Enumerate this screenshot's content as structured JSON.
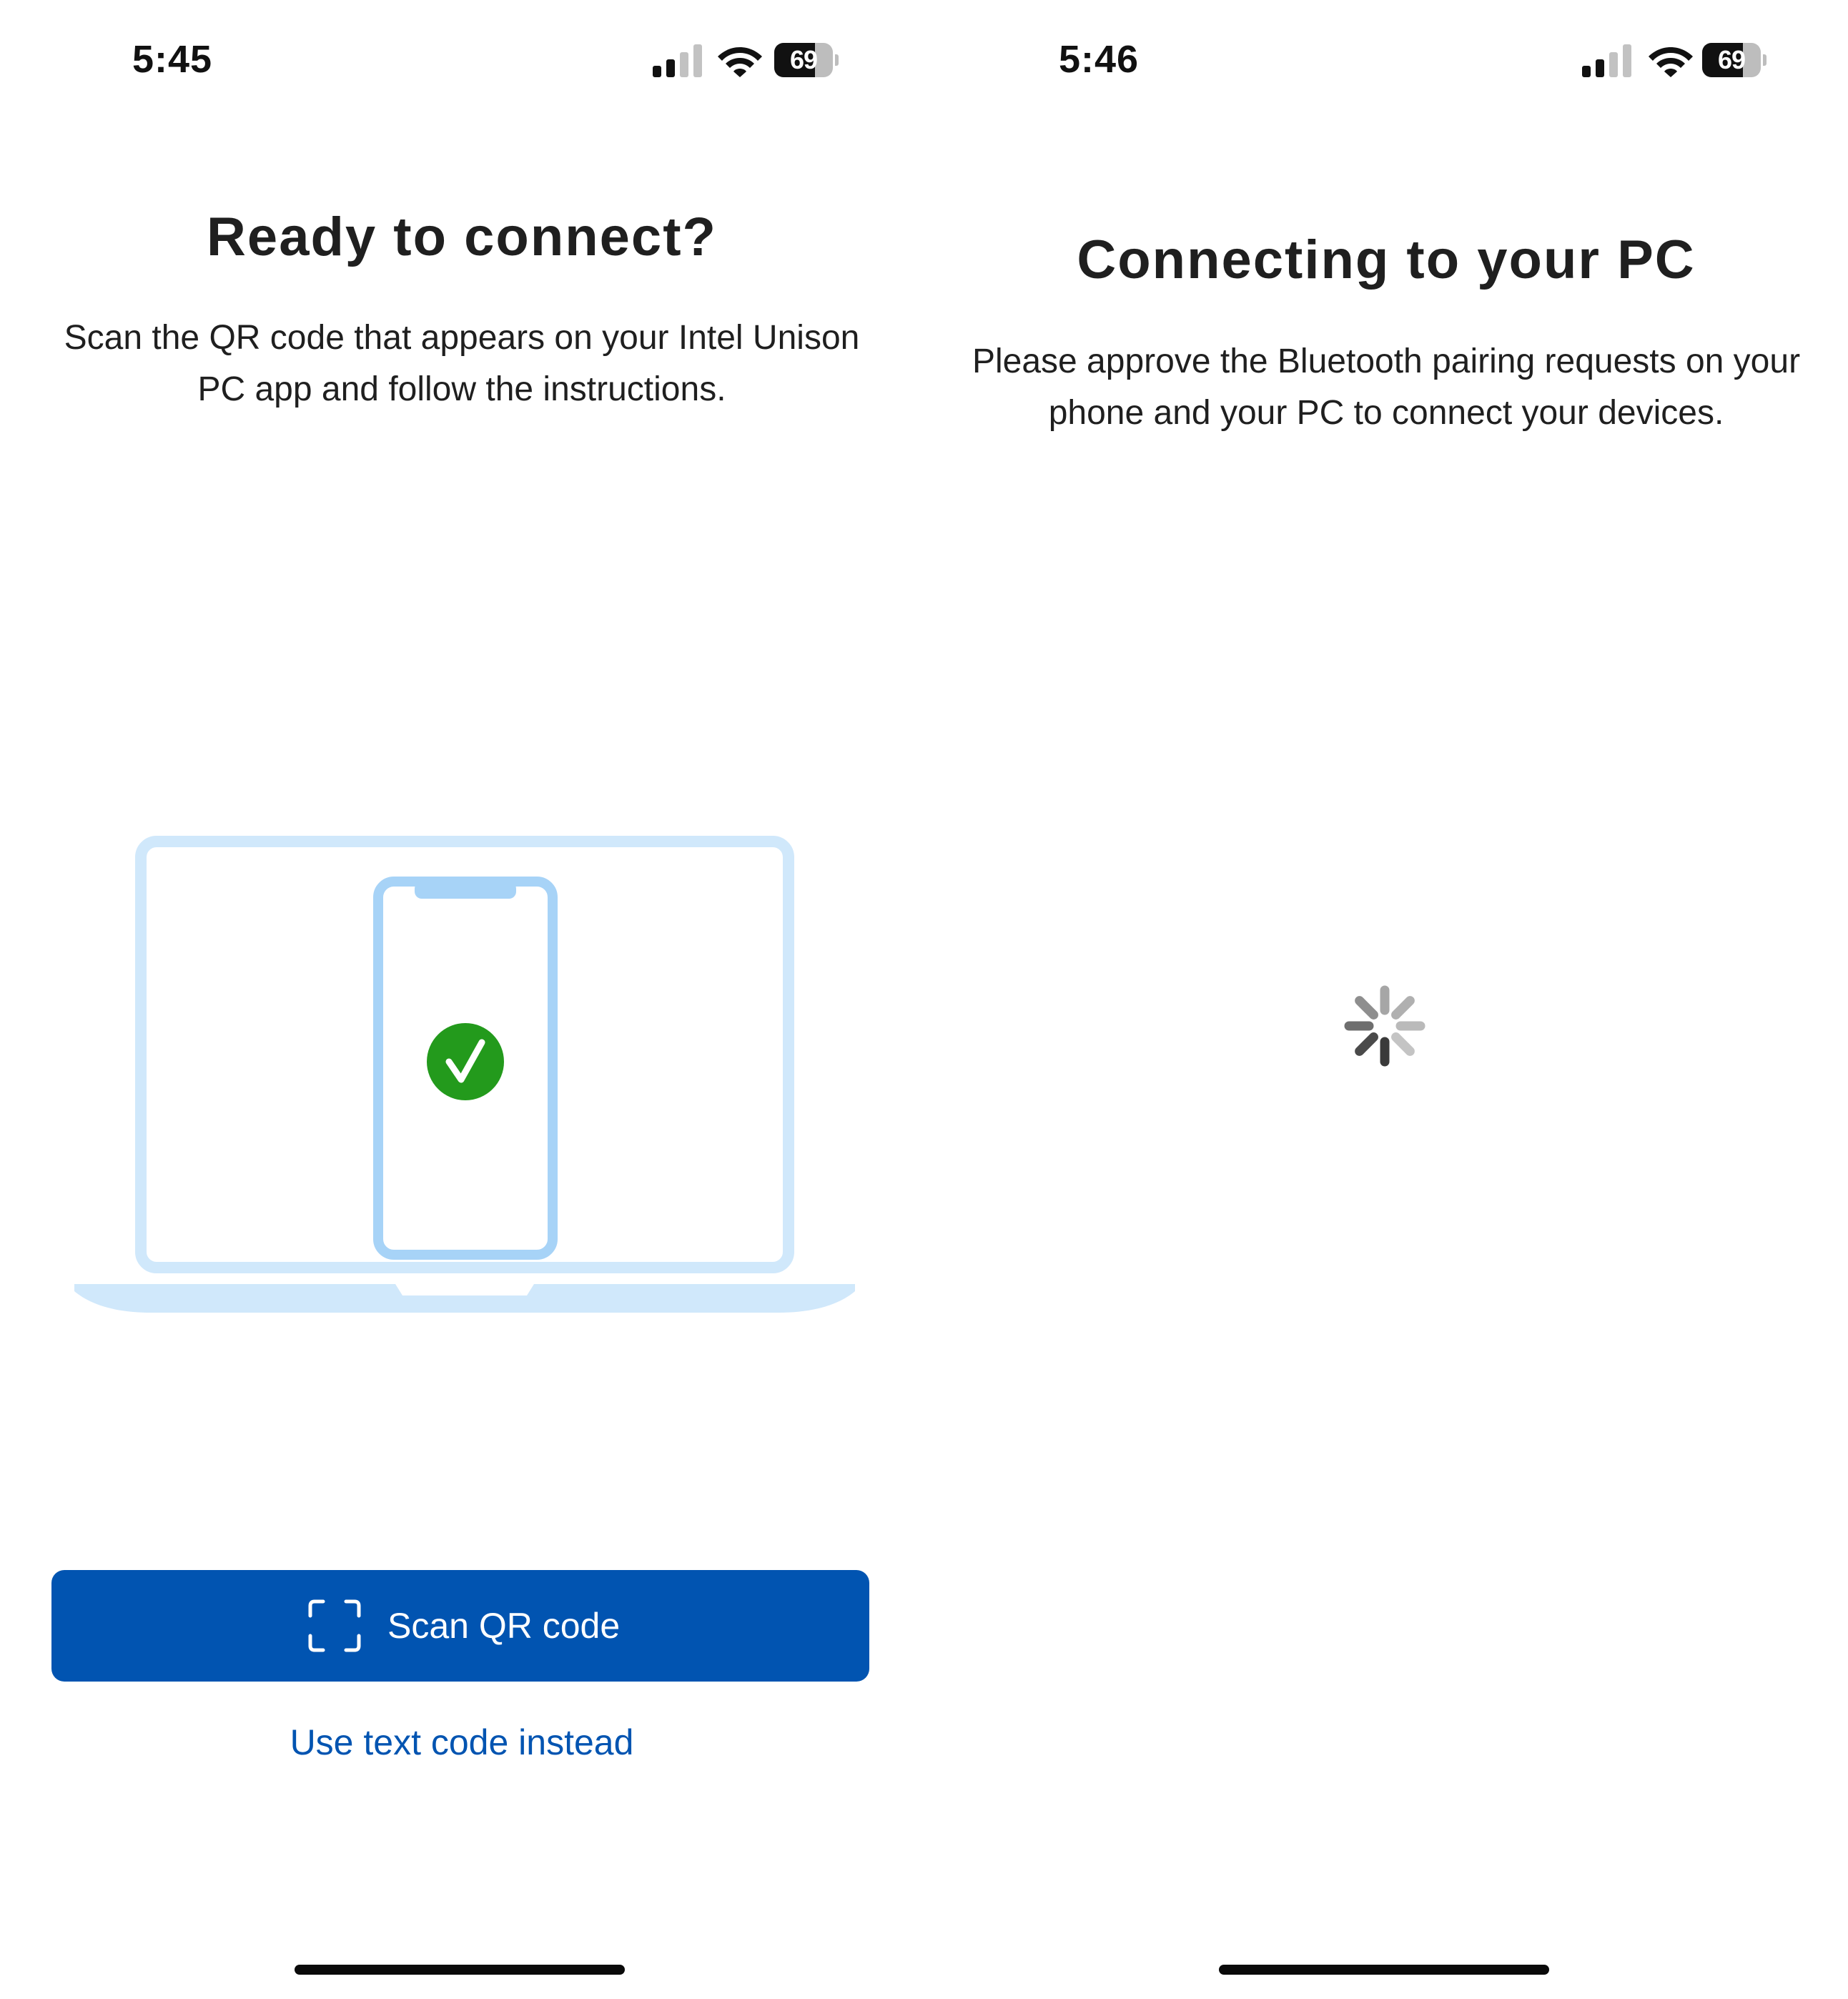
{
  "screens": [
    {
      "status_bar": {
        "time": "5:45",
        "battery_level": "69",
        "battery_fraction": 0.69,
        "icons": [
          "cellular-signal-icon",
          "wifi-icon",
          "battery-icon"
        ]
      },
      "title": "Ready to connect?",
      "description": "Scan the QR code that appears on your Intel Unison PC app and follow the instructions.",
      "illustration": {
        "icons": [
          "laptop-icon",
          "phone-icon",
          "checkmark-icon"
        ],
        "colors": {
          "device_outline": "#a7d3f7",
          "laptop_base": "#d0e8fb",
          "check_circle": "#239a1c"
        }
      },
      "primary_button": {
        "label": "Scan QR code",
        "icon": "qr-scan-icon"
      },
      "secondary_link": {
        "label": "Use text code instead"
      }
    },
    {
      "status_bar": {
        "time": "5:46",
        "battery_level": "69",
        "battery_fraction": 0.69,
        "icons": [
          "cellular-signal-icon",
          "wifi-icon",
          "battery-icon"
        ]
      },
      "title": "Connecting to your PC",
      "description": "Please approve the Bluetooth pairing requests on your phone and your PC to connect your devices.",
      "loading_indicator": {
        "icon": "loading-spinner-icon"
      }
    }
  ],
  "colors": {
    "accent": "#0154b1",
    "text_primary": "#1f1f1f",
    "background": "#ffffff"
  }
}
